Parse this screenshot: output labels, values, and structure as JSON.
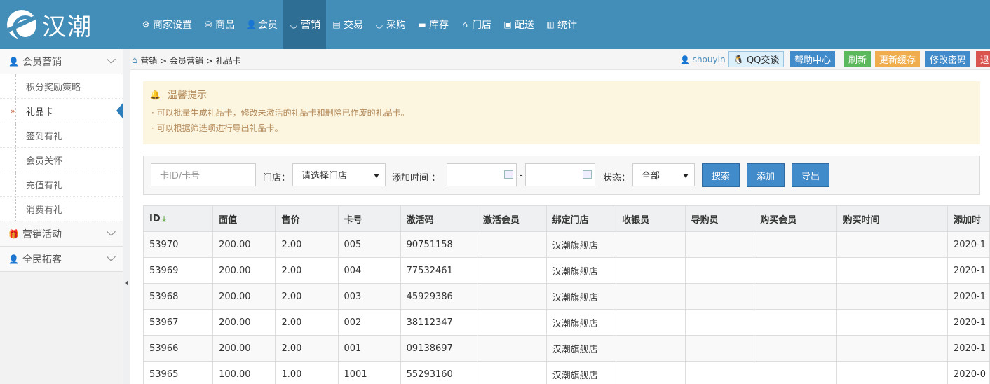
{
  "brand": {
    "name": "汉潮"
  },
  "nav": [
    {
      "icon": "gear-icon",
      "glyph": "⚙",
      "label": "商家设置"
    },
    {
      "icon": "box-icon",
      "glyph": "⛁",
      "label": "商品"
    },
    {
      "icon": "user-icon",
      "glyph": "👤",
      "label": "会员"
    },
    {
      "icon": "bowl-icon",
      "glyph": "◡",
      "label": "营销",
      "active": true
    },
    {
      "icon": "file-icon",
      "glyph": "▤",
      "label": "交易"
    },
    {
      "icon": "cart-icon",
      "glyph": "◡",
      "label": "采购"
    },
    {
      "icon": "warehouse-icon",
      "glyph": "▬",
      "label": "库存"
    },
    {
      "icon": "home-icon",
      "glyph": "⌂",
      "label": "门店"
    },
    {
      "icon": "truck-icon",
      "glyph": "▣",
      "label": "配送"
    },
    {
      "icon": "bar-chart-icon",
      "glyph": "▥",
      "label": "统计"
    }
  ],
  "sidebar": {
    "groups": [
      {
        "label": "会员营销",
        "icon": "users-icon",
        "items": [
          "积分奖励策略",
          "礼品卡",
          "签到有礼",
          "会员关怀",
          "充值有礼",
          "消费有礼"
        ],
        "active_item": "礼品卡"
      },
      {
        "label": "营销活动",
        "icon": "gift-icon"
      },
      {
        "label": "全民拓客",
        "icon": "users-icon"
      }
    ]
  },
  "breadcrumb": {
    "text": "营销 > 会员营销 > 礼品卡"
  },
  "toolbar": {
    "user": "shouyin",
    "qq_label": "QQ交谈",
    "help_label": "帮助中心",
    "refresh_label": "刷新",
    "cache_label": "更新缓存",
    "password_label": "修改密码",
    "logout_label": "退",
    "colors": {
      "help": "#428bca",
      "refresh": "#5cb85c",
      "cache": "#f0ad4e",
      "password": "#428bca",
      "logout": "#d9534f"
    }
  },
  "notice": {
    "title": "温馨提示",
    "lines": [
      "· 可以批量生成礼品卡，修改未激活的礼品卡和删除已作废的礼品卡。",
      "· 可以根据筛选项进行导出礼品卡。"
    ]
  },
  "filter": {
    "card_placeholder": "卡ID/卡号",
    "store_label": "门店：",
    "store_value": "请选择门店",
    "time_label": "添加时间 ：",
    "dash": "-",
    "status_label": "状态：",
    "status_value": "全部",
    "search_label": "搜索",
    "add_label": "添加",
    "export_label": "导出"
  },
  "table": {
    "headers": [
      "ID",
      "面值",
      "售价",
      "卡号",
      "激活码",
      "激活会员",
      "绑定门店",
      "收银员",
      "导购员",
      "购买会员",
      "购买时间",
      "添加时"
    ],
    "rows": [
      [
        "53970",
        "200.00",
        "2.00",
        "005",
        "90751158",
        "",
        "汉潮旗舰店",
        "",
        "",
        "",
        "",
        "2020-1"
      ],
      [
        "53969",
        "200.00",
        "2.00",
        "004",
        "77532461",
        "",
        "汉潮旗舰店",
        "",
        "",
        "",
        "",
        "2020-1"
      ],
      [
        "53968",
        "200.00",
        "2.00",
        "003",
        "45929386",
        "",
        "汉潮旗舰店",
        "",
        "",
        "",
        "",
        "2020-1"
      ],
      [
        "53967",
        "200.00",
        "2.00",
        "002",
        "38112347",
        "",
        "汉潮旗舰店",
        "",
        "",
        "",
        "",
        "2020-1"
      ],
      [
        "53966",
        "200.00",
        "2.00",
        "001",
        "09138697",
        "",
        "汉潮旗舰店",
        "",
        "",
        "",
        "",
        "2020-1"
      ],
      [
        "53965",
        "100.00",
        "1.00",
        "1001",
        "55293160",
        "",
        "汉潮旗舰店",
        "",
        "",
        "",
        "",
        "2020-0"
      ]
    ]
  }
}
